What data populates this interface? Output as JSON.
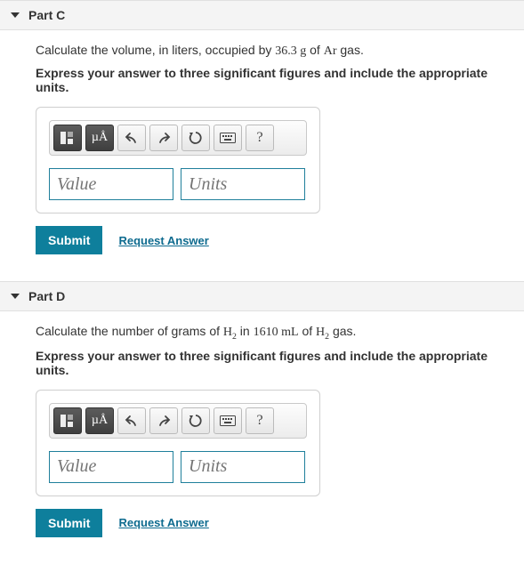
{
  "parts": [
    {
      "title": "Part C",
      "prompt_pre": "Calculate the volume, in liters, occupied by ",
      "prompt_val": "36.3 g",
      "prompt_mid": " of ",
      "prompt_sub": "Ar",
      "prompt_post": " gas.",
      "instruction": "Express your answer to three significant figures and include the appropriate units.",
      "value_placeholder": "Value",
      "units_placeholder": "Units",
      "submit": "Submit",
      "request": "Request Answer",
      "units_label": "µÅ"
    },
    {
      "title": "Part D",
      "prompt_pre": "Calculate the number of grams of ",
      "prompt_sub1": "H",
      "prompt_sub1n": "2",
      "prompt_mid": " in ",
      "prompt_val": "1610 mL",
      "prompt_mid2": " of ",
      "prompt_sub2": "H",
      "prompt_sub2n": "2",
      "prompt_post": " gas.",
      "instruction": "Express your answer to three significant figures and include the appropriate units.",
      "value_placeholder": "Value",
      "units_placeholder": "Units",
      "submit": "Submit",
      "request": "Request Answer",
      "units_label": "µÅ"
    }
  ]
}
